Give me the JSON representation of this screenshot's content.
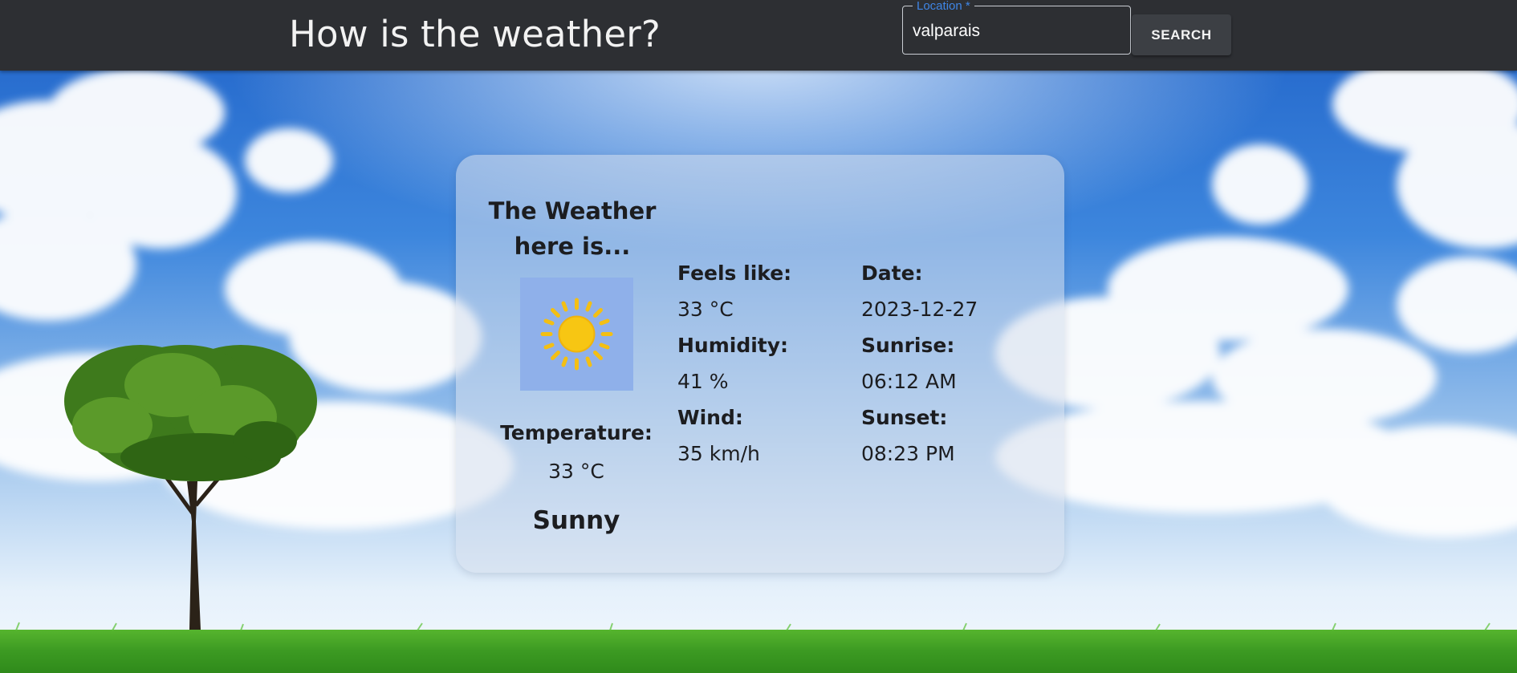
{
  "header": {
    "title": "How is the weather?",
    "location_label": "Location *",
    "location_value": "valparais",
    "search_label": "SEARCH"
  },
  "card": {
    "heading": "The Weather here is...",
    "icon": "sun-icon",
    "temperature_label": "Temperature:",
    "temperature_value": "33 °C",
    "condition": "Sunny",
    "feels_like_label": "Feels like:",
    "feels_like_value": "33 °C",
    "humidity_label": "Humidity:",
    "humidity_value": "41 %",
    "wind_label": "Wind:",
    "wind_value": "35 km/h",
    "date_label": "Date:",
    "date_value": "2023-12-27",
    "sunrise_label": "Sunrise:",
    "sunrise_value": "06:12 AM",
    "sunset_label": "Sunset:",
    "sunset_value": "08:23 PM"
  },
  "colors": {
    "header_bg": "#2d2f33",
    "accent": "#3f86e6",
    "sky": "#2a6fd1",
    "grass": "#3fa52a",
    "sun": "#f7c613"
  }
}
